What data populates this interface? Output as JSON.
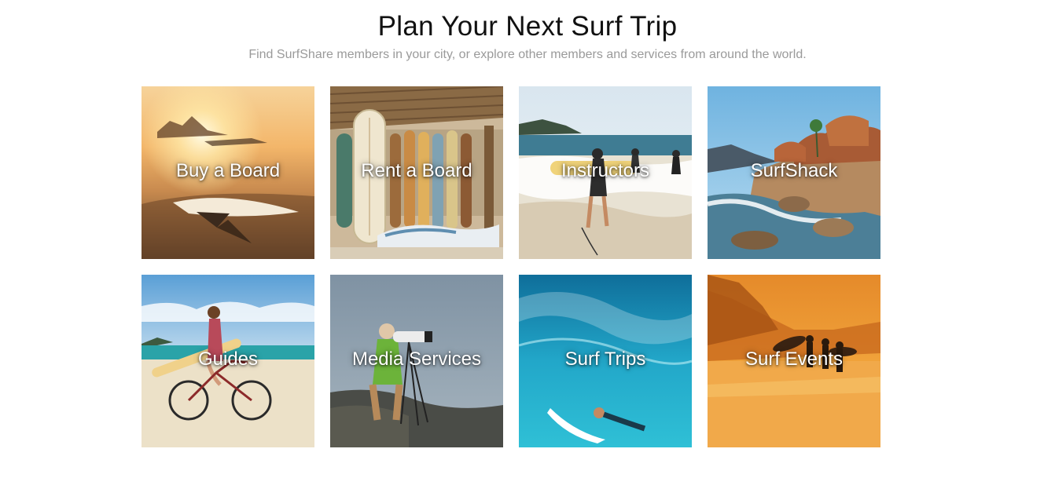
{
  "header": {
    "title": "Plan Your Next Surf Trip",
    "subtitle": "Find SurfShare members in your city, or explore other members and services from around the world."
  },
  "tiles": [
    {
      "label": "Buy a Board",
      "image": "surfboard-fin-sunset-beach"
    },
    {
      "label": "Rent a Board",
      "image": "surfboards-rack-beach-hut"
    },
    {
      "label": "Instructors",
      "image": "surfers-walking-into-waves"
    },
    {
      "label": "SurfShack",
      "image": "rocky-coast-thatched-huts"
    },
    {
      "label": "Guides",
      "image": "woman-on-bicycle-with-surfboard"
    },
    {
      "label": "Media Services",
      "image": "photographer-on-rocks"
    },
    {
      "label": "Surf Trips",
      "image": "underwater-surfer-blue-wave"
    },
    {
      "label": "Surf Events",
      "image": "surfers-silhouette-orange-sunset"
    }
  ]
}
